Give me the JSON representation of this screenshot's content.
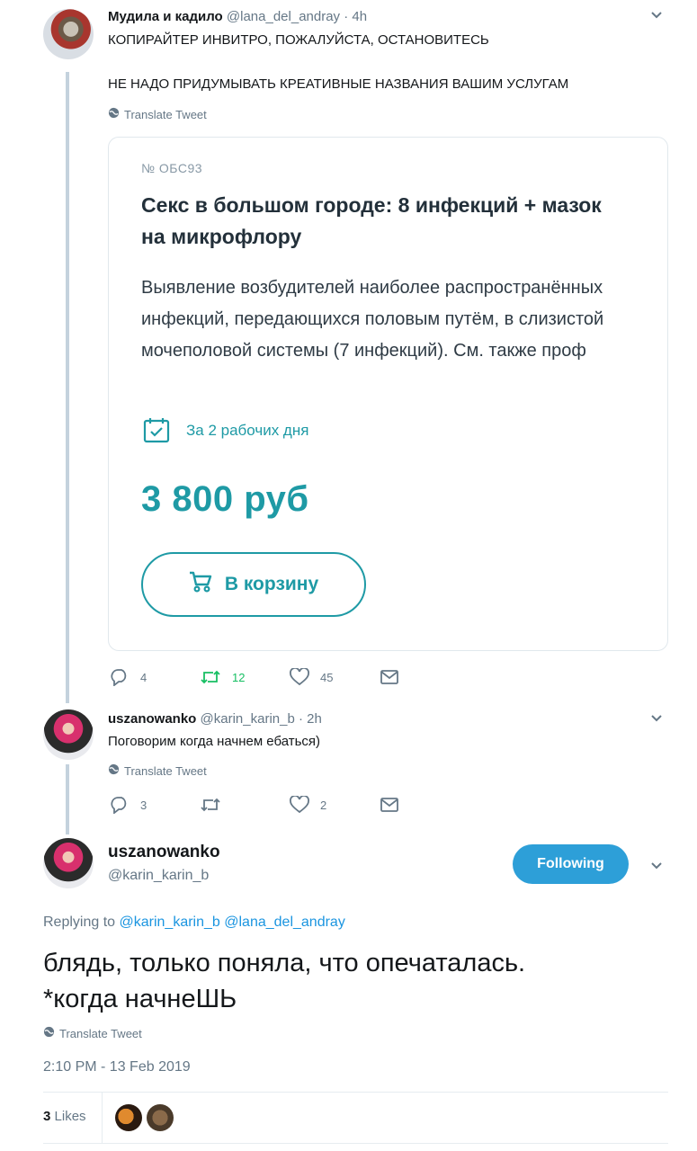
{
  "tweet1": {
    "name": "Мудила и кадило",
    "handle": "@lana_del_andray",
    "time": "· 4h",
    "line1": "КОПИРАЙТЕР ИНВИТРО, ПОЖАЛУЙСТА, ОСТАНОВИТЕСЬ",
    "line2": "НЕ НАДО ПРИДУМЫВАТЬ КРЕАТИВНЫЕ НАЗВАНИЯ ВАШИМ УСЛУГАМ",
    "translate": "Translate Tweet",
    "card": {
      "number": "№ ОБС93",
      "title": "Секс в большом городе: 8 инфекций + мазок на микрофлору",
      "description": "Выявление возбудителей наиболее распространённых инфекций, передающихся половым путём, в слизистой мочеполовой системы (7 инфекций). См. также проф",
      "days": "За 2 рабочих дня",
      "price": "3 800 руб",
      "cart_button": "В корзину"
    },
    "replies": "4",
    "retweets": "12",
    "likes": "45"
  },
  "tweet2": {
    "name": "uszanowanko",
    "handle": "@karin_karin_b",
    "time": "· 2h",
    "text": "Поговорим когда начнем ебаться)",
    "translate": "Translate Tweet",
    "replies": "3",
    "likes": "2"
  },
  "main_tweet": {
    "name": "uszanowanko",
    "handle": "@karin_karin_b",
    "follow_button": "Following",
    "replying_prefix": "Replying to",
    "replying_to_1": "@karin_karin_b",
    "replying_to_2": "@lana_del_andray",
    "text": "блядь, только поняла, что опечаталась.\n*когда начнеШЬ",
    "translate": "Translate Tweet",
    "datetime": "2:10 PM - 13 Feb 2019",
    "likes_count": "3",
    "likes_label": "Likes"
  },
  "colors": {
    "link": "#1b95e0",
    "retweet": "#17bf63",
    "brand_teal": "#1e9aa5",
    "follow_bg": "#2d9fd8"
  }
}
